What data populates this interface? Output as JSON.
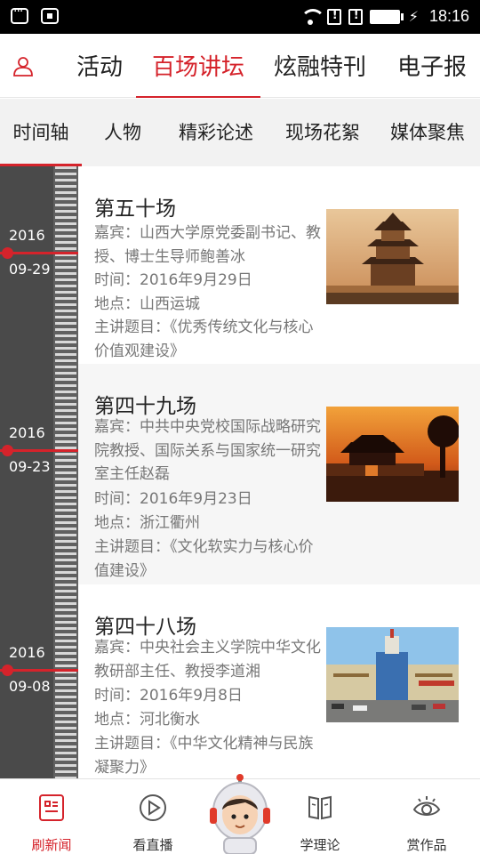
{
  "status_bar": {
    "time": "18:16"
  },
  "top_nav": {
    "tabs": [
      {
        "label": "活动",
        "active": false
      },
      {
        "label": "百场讲坛",
        "active": true
      },
      {
        "label": "炫融特刊",
        "active": false
      },
      {
        "label": "电子报",
        "active": false
      }
    ]
  },
  "sub_nav": {
    "items": [
      {
        "label": "时间轴",
        "active": true
      },
      {
        "label": "人物",
        "active": false
      },
      {
        "label": "精彩论述",
        "active": false
      },
      {
        "label": "现场花絮",
        "active": false
      },
      {
        "label": "媒体聚焦",
        "active": false
      }
    ]
  },
  "timeline": [
    {
      "year": "2016",
      "date": "09-29"
    },
    {
      "year": "2016",
      "date": "09-23"
    },
    {
      "year": "2016",
      "date": "09-08"
    }
  ],
  "lectures": [
    {
      "title": "第五十场",
      "guest": "嘉宾：山西大学原党委副书记、教授、博士生导师鲍善冰",
      "time": "时间：2016年9月29日",
      "place": "地点：山西运城",
      "topic": "主讲题目：《优秀传统文化与核心价值观建设》",
      "image": "pavilion-sunset-photo"
    },
    {
      "title": "第四十九场",
      "guest": "嘉宾：中共中央党校国际战略研究院教授、国际关系与国家统一研究室主任赵磊",
      "time": "时间：2016年9月23日",
      "place": "地点：浙江衢州",
      "topic": "主讲题目：《文化软实力与核心价值建设》",
      "image": "city-gate-sunset-photo"
    },
    {
      "title": "第四十八场",
      "guest": "嘉宾：中央社会主义学院中华文化教研部主任、教授李道湘",
      "time": "时间：2016年9月8日",
      "place": "地点：河北衡水",
      "topic": "主讲题目：《中华文化精神与民族凝聚力》",
      "image": "train-station-photo"
    }
  ],
  "bottom_nav": {
    "items": [
      {
        "label": "刷新闻",
        "icon": "news-icon",
        "active": true
      },
      {
        "label": "看直播",
        "icon": "play-icon",
        "active": false
      },
      {
        "label": "学理论",
        "icon": "book-icon",
        "active": false
      },
      {
        "label": "赏作品",
        "icon": "eye-icon",
        "active": false
      }
    ]
  },
  "colors": {
    "accent": "#d5232b",
    "timeline_bg": "#4a4a4a",
    "detail_text": "#777777"
  }
}
